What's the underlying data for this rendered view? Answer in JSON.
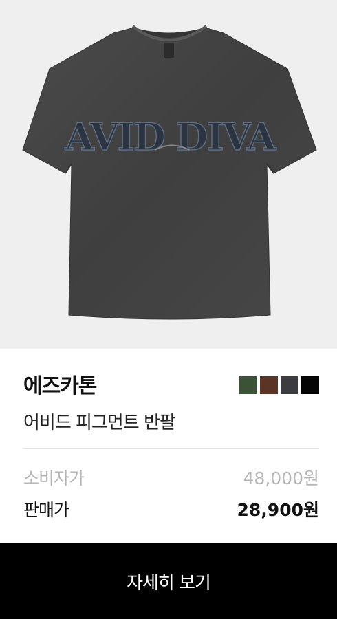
{
  "product": {
    "image_alt": "AVID DIVA",
    "brand": "에즈카톤",
    "name": "어비드 피그먼트 반팔",
    "colors": [
      "#3c5236",
      "#5a3526",
      "#3b3c3f",
      "#050505"
    ]
  },
  "pricing": {
    "msrp_label": "소비자가",
    "msrp_value": "48,000원",
    "sale_label": "판매가",
    "sale_value": "28,900원"
  },
  "actions": {
    "detail_label": "자세히 보기"
  }
}
